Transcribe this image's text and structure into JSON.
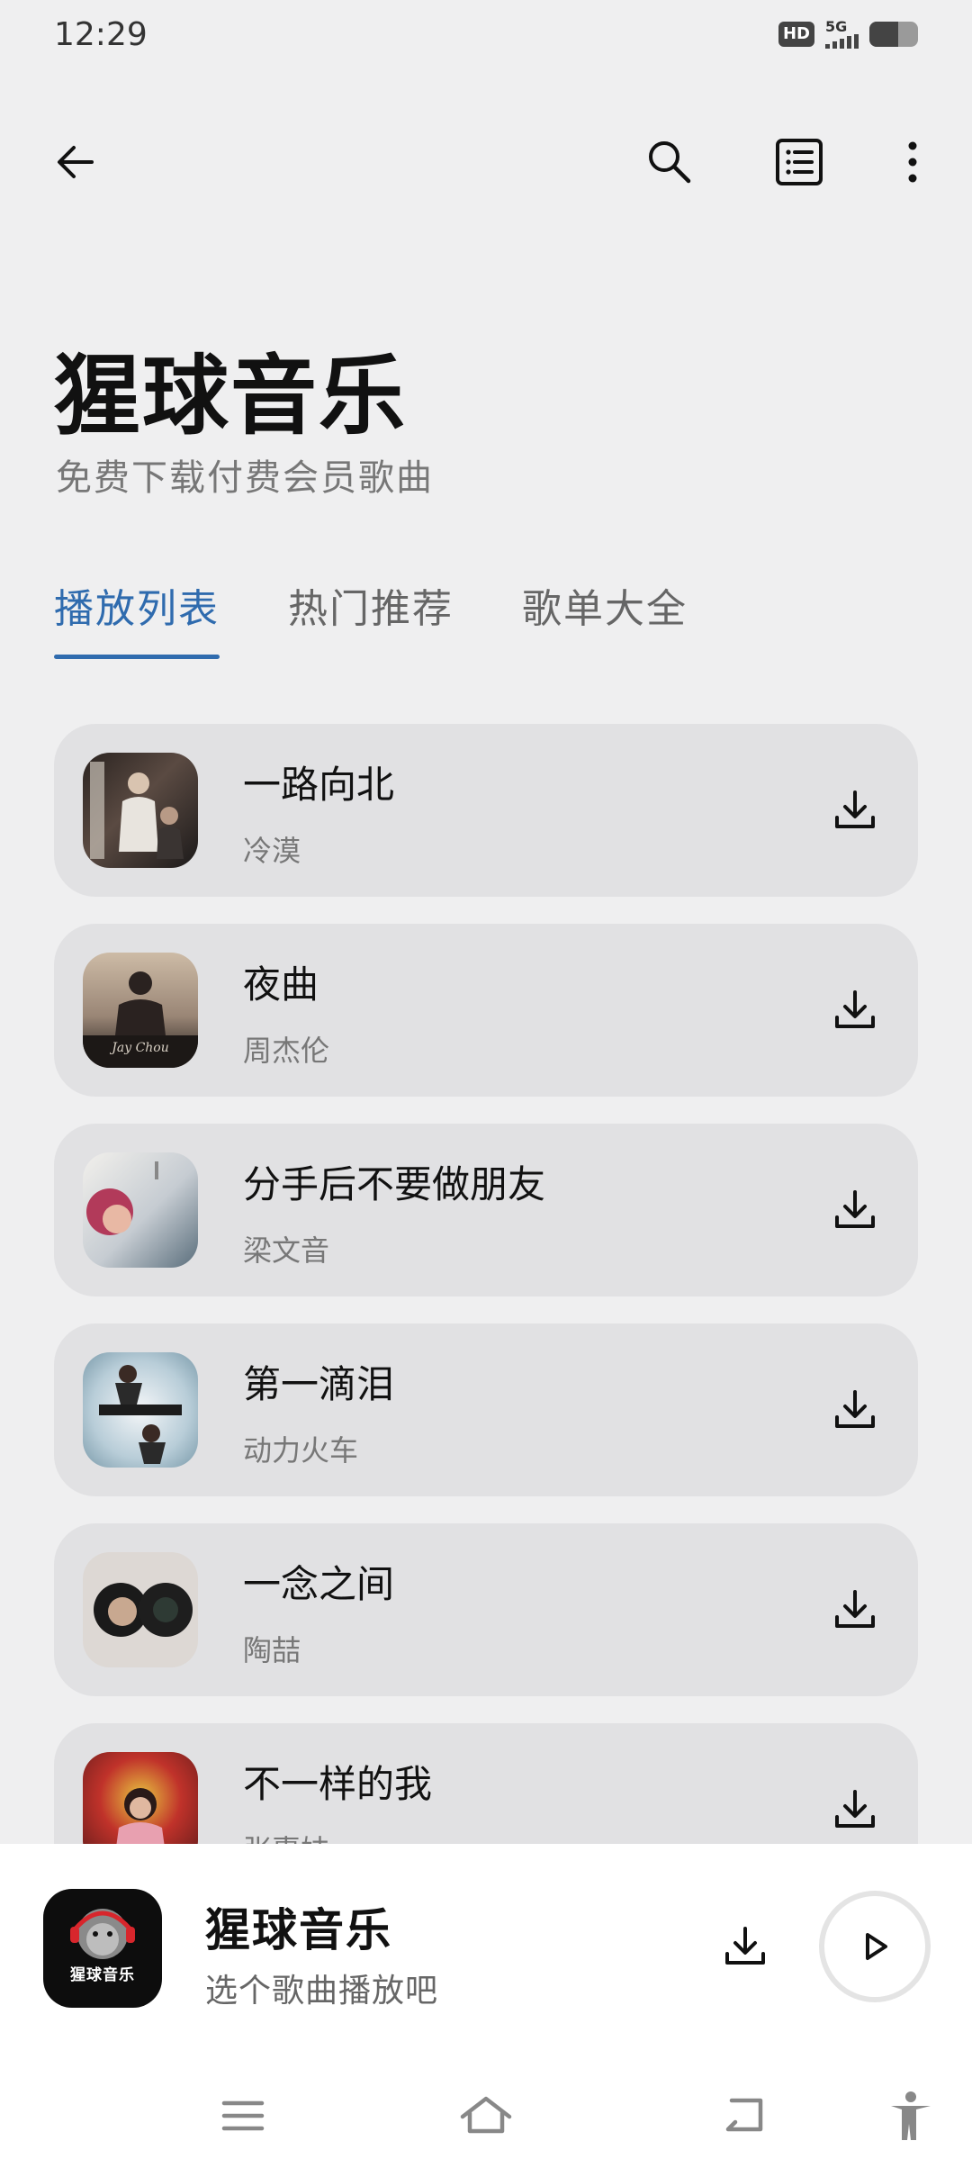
{
  "status": {
    "time": "12:29",
    "hd": "HD",
    "network": "5G",
    "battery_level": 0.6
  },
  "header": {
    "icons": [
      "arrow-left-icon",
      "search-icon",
      "list-icon",
      "more-vertical-icon"
    ]
  },
  "app": {
    "title": "猩球音乐",
    "subtitle": "免费下载付费会员歌曲"
  },
  "tabs": [
    {
      "label": "播放列表",
      "active": true
    },
    {
      "label": "热门推荐",
      "active": false
    },
    {
      "label": "歌单大全",
      "active": false
    }
  ],
  "songs": [
    {
      "title": "一路向北",
      "artist": "冷漠"
    },
    {
      "title": "夜曲",
      "artist": "周杰伦"
    },
    {
      "title": "分手后不要做朋友",
      "artist": "梁文音"
    },
    {
      "title": "第一滴泪",
      "artist": "动力火车"
    },
    {
      "title": "一念之间",
      "artist": "陶喆"
    },
    {
      "title": "不一样的我",
      "artist": "张惠妹"
    }
  ],
  "player": {
    "logo_text": "猩球音乐",
    "title": "猩球音乐",
    "subtitle": "选个歌曲播放吧"
  },
  "colors": {
    "accent": "#2f6bae",
    "background": "#efeff0",
    "card": "#e1e1e3"
  }
}
